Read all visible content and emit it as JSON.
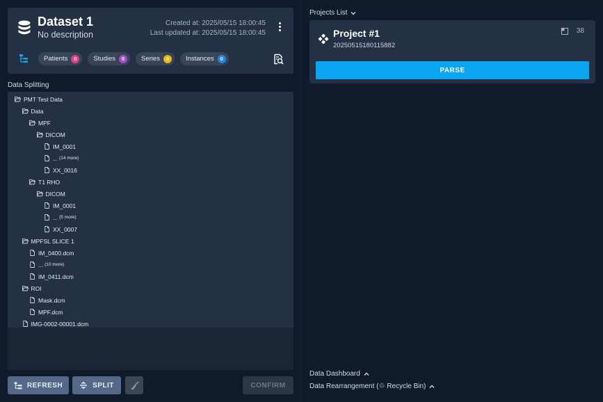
{
  "dataset": {
    "title": "Dataset 1",
    "description": "No description",
    "created": "Created at: 2025/05/15 18:00:45",
    "updated": "Last updated at: 2025/05/15 18:00:45",
    "chips": [
      {
        "label": "Patients",
        "count": "0",
        "color": "#e5417d"
      },
      {
        "label": "Studies",
        "count": "0",
        "color": "#a64cc9"
      },
      {
        "label": "Series",
        "count": "0",
        "color": "#e8b90c"
      },
      {
        "label": "Instances",
        "count": "0",
        "color": "#1e88e5"
      }
    ]
  },
  "splitting": {
    "label": "Data Splitting",
    "tree": [
      {
        "depth": 0,
        "type": "folder",
        "name": "PMT Test Data"
      },
      {
        "depth": 1,
        "type": "folder",
        "name": "Data"
      },
      {
        "depth": 2,
        "type": "folder",
        "name": "MPF"
      },
      {
        "depth": 3,
        "type": "folder",
        "name": "DICOM"
      },
      {
        "depth": 4,
        "type": "file",
        "name": "IM_0001"
      },
      {
        "depth": 4,
        "type": "file",
        "name": "...",
        "extra": "(14 more)"
      },
      {
        "depth": 4,
        "type": "file",
        "name": "XX_0016"
      },
      {
        "depth": 2,
        "type": "folder",
        "name": "T1 RHO"
      },
      {
        "depth": 3,
        "type": "folder",
        "name": "DICOM"
      },
      {
        "depth": 4,
        "type": "file",
        "name": "IM_0001"
      },
      {
        "depth": 4,
        "type": "file",
        "name": "...",
        "extra": "(5 more)"
      },
      {
        "depth": 4,
        "type": "file",
        "name": "XX_0007"
      },
      {
        "depth": 1,
        "type": "folder",
        "name": "MPFSL SLICE 1"
      },
      {
        "depth": 2,
        "type": "file",
        "name": "IM_0400.dcm"
      },
      {
        "depth": 2,
        "type": "file",
        "name": "...",
        "extra": "(10 more)"
      },
      {
        "depth": 2,
        "type": "file",
        "name": "IM_0411.dcm"
      },
      {
        "depth": 1,
        "type": "folder",
        "name": "ROI"
      },
      {
        "depth": 2,
        "type": "file",
        "name": "Mask.dcm"
      },
      {
        "depth": 2,
        "type": "file",
        "name": "MPF.dcm"
      },
      {
        "depth": 1,
        "type": "file",
        "name": "IMG-0002-00001.dcm"
      }
    ]
  },
  "buttons": {
    "refresh": "REFRESH",
    "split": "SPLIT",
    "confirm": "CONFIRM"
  },
  "projects": {
    "header": "Projects List",
    "project": {
      "title": "Project #1",
      "id": "20250515180115882",
      "count": "38",
      "parse": "PARSE"
    }
  },
  "footer": {
    "dashboard": "Data Dashboard",
    "rearrangement": "Data Rearrangement (♲ Recycle Bin)"
  }
}
